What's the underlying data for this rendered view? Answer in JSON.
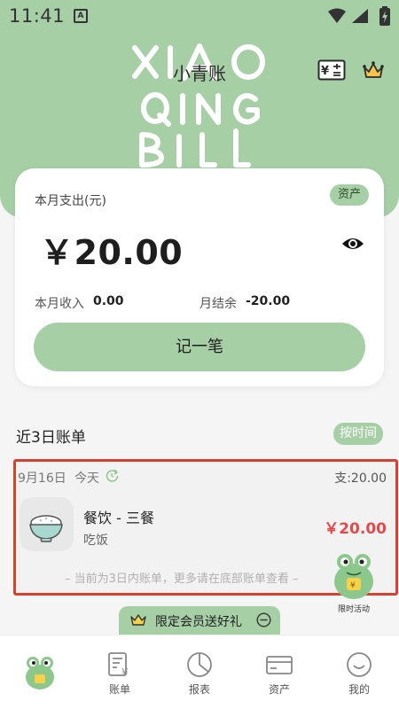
{
  "status_bar": {
    "time": "11:41",
    "notification_icon": "a-notification-icon",
    "wifi_icon": "wifi-icon",
    "signal_icon": "signal-icon",
    "battery_icon": "battery-charging-icon"
  },
  "header": {
    "decoration_text": [
      "XIAO",
      "QING",
      "BILL"
    ],
    "title": "小青账",
    "calculator_icon": "calculator-icon",
    "vip_icon": "crown-icon"
  },
  "summary": {
    "label": "本月支出(元)",
    "assets_badge": "资产",
    "amount": "￥20.00",
    "visibility_icon": "eye-icon",
    "income_label": "本月收入",
    "income_value": "0.00",
    "balance_label": "月结余",
    "balance_value": "-20.00",
    "record_button": "记一笔"
  },
  "recent": {
    "title": "近3日账单",
    "sort_button": "按时间",
    "day": {
      "date": "9月16日",
      "weekday": "今天",
      "total": "支:20.00",
      "bills": [
        {
          "category": "餐饮 - 三餐",
          "note": "吃饭",
          "amount": "￥20.00",
          "icon": "rice-bowl-icon"
        }
      ]
    },
    "hint": "– 当前为3日内账单，更多请在底部账单查看 –"
  },
  "promo": {
    "frog_label": "限时活动",
    "member_banner": "限定会员送好礼"
  },
  "nav": {
    "items": [
      {
        "label": "",
        "icon": "frog-home-icon"
      },
      {
        "label": "账单",
        "icon": "bill-icon"
      },
      {
        "label": "报表",
        "icon": "pie-chart-icon"
      },
      {
        "label": "资产",
        "icon": "card-icon"
      },
      {
        "label": "我的",
        "icon": "smile-icon"
      }
    ]
  },
  "colors": {
    "brand_green": "#a6cfa6",
    "expense_red": "#e04a4a",
    "highlight_border": "#d74230"
  }
}
